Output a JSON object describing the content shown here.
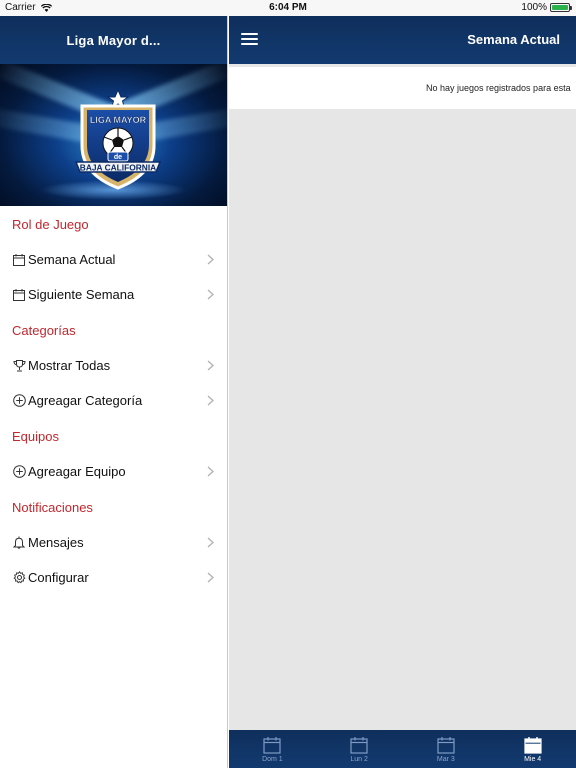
{
  "status_bar": {
    "carrier": "Carrier",
    "time": "6:04 PM",
    "battery": "100%"
  },
  "sidebar": {
    "nav_title": "Liga Mayor d...",
    "sections": [
      {
        "title": "Rol de Juego",
        "items": [
          {
            "label": "Semana Actual",
            "icon": "calendar-icon"
          },
          {
            "label": "Siguiente Semana",
            "icon": "calendar-icon"
          }
        ]
      },
      {
        "title": "Categorías",
        "items": [
          {
            "label": "Mostrar Todas",
            "icon": "trophy-icon"
          },
          {
            "label": "Agreagar Categoría",
            "icon": "plus-circle-icon"
          }
        ]
      },
      {
        "title": "Equipos",
        "items": [
          {
            "label": "Agreagar Equipo",
            "icon": "plus-circle-icon"
          }
        ]
      },
      {
        "title": "Notificaciones",
        "items": [
          {
            "label": "Mensajes",
            "icon": "bell-icon"
          },
          {
            "label": "Configurar",
            "icon": "gear-icon"
          }
        ]
      }
    ],
    "logo_text": {
      "top": "LIGA MAYOR",
      "middle": "de",
      "bottom": "BAJA CALIFORNIA"
    }
  },
  "main": {
    "nav_title": "Semana Actual",
    "empty_message": "No hay juegos registrados para esta",
    "tabs": [
      {
        "label": "Dom 1",
        "active": false
      },
      {
        "label": "Lun 2",
        "active": false
      },
      {
        "label": "Mar 3",
        "active": false
      },
      {
        "label": "Mie 4",
        "active": true
      }
    ]
  },
  "colors": {
    "nav_blue": "#123a70",
    "section_red": "#c1272d",
    "content_gray": "#e6e6e6",
    "battery_green": "#2bb24c"
  }
}
